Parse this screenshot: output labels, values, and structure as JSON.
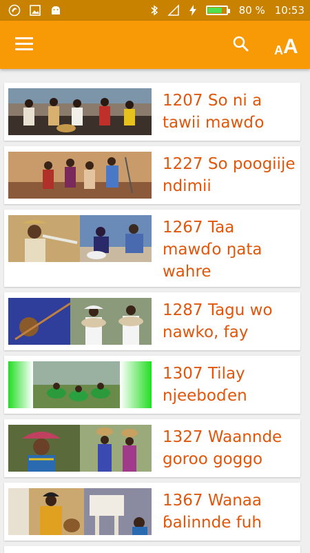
{
  "status_bar": {
    "battery_percent": "80 %",
    "time": "10:53",
    "battery_level": 0.8,
    "icons": [
      "app-icon",
      "gallery-icon",
      "android-icon",
      "bluetooth-icon",
      "signal-icon",
      "charging-icon",
      "battery-icon"
    ]
  },
  "toolbar": {
    "menu_icon": "menu-icon",
    "search_icon": "search-icon",
    "font_size_small": "A",
    "font_size_big": "A"
  },
  "colors": {
    "status_bar": "#c98200",
    "toolbar": "#f79a05",
    "title": "#e0560b",
    "background": "#efefef"
  },
  "songs": [
    {
      "title": "1207 So ni a tawii mawɗo"
    },
    {
      "title": "1227 So poogiije ndimii"
    },
    {
      "title": "1267 Taa mawɗo ŋata wahre"
    },
    {
      "title": "1287 Tagu wo nawko, fay"
    },
    {
      "title": "1307 Tilay njeeboɗen"
    },
    {
      "title": "1327 Waannde goroo goggo"
    },
    {
      "title": "1367 Wanaa ɓalinnde fuh"
    }
  ]
}
